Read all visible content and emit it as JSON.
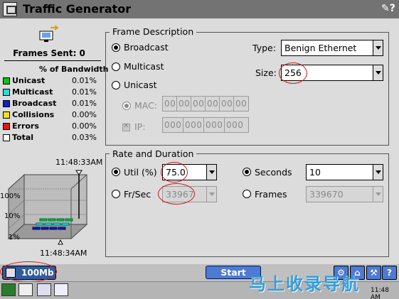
{
  "window": {
    "title": "Traffic Generator"
  },
  "stats": {
    "frames_sent": "Frames Sent: 0",
    "bandwidth_header": "% of Bandwidth",
    "rows": [
      {
        "label": "Unicast",
        "value": "0.01%",
        "color": "#10c020"
      },
      {
        "label": "Multicast",
        "value": "0.01%",
        "color": "#30d8d8"
      },
      {
        "label": "Broadcast",
        "value": "0.01%",
        "color": "#1020c8"
      },
      {
        "label": "Collisions",
        "value": "0.00%",
        "color": "#f0e020"
      },
      {
        "label": "Errors",
        "value": "0.00%",
        "color": "#e01818"
      },
      {
        "label": "Total",
        "value": "0.03%",
        "color": "#ffffff"
      }
    ]
  },
  "chart": {
    "time_start": "11:48:33AM",
    "time_end": "11:48:34AM",
    "y_labels": [
      "100%",
      "10%",
      "1%"
    ]
  },
  "frame_description": {
    "title": "Frame Description",
    "broadcast_label": "Broadcast",
    "multicast_label": "Multicast",
    "unicast_label": "Unicast",
    "selected": "Broadcast",
    "mac_label": "MAC:",
    "mac_segments": [
      "00",
      "00",
      "00",
      "00",
      "00",
      "00"
    ],
    "ip_label": "IP:",
    "ip_segments": [
      "000",
      "000",
      "000",
      "000"
    ],
    "type_label": "Type:",
    "type_value": "Benign Ethernet",
    "size_label": "Size:",
    "size_value": "256"
  },
  "rate_duration": {
    "title": "Rate and Duration",
    "util_label": "Util (%)",
    "util_value": "75.0",
    "frsec_label": "Fr/Sec",
    "frsec_value": "33967",
    "seconds_label": "Seconds",
    "seconds_value": "10",
    "frames_label": "Frames",
    "frames_value": "339670"
  },
  "bottom": {
    "speed_label": "100Mb",
    "start_label": "Start"
  },
  "taskbar": {
    "time": "11:48 AM"
  },
  "watermark": "马上收录导航"
}
